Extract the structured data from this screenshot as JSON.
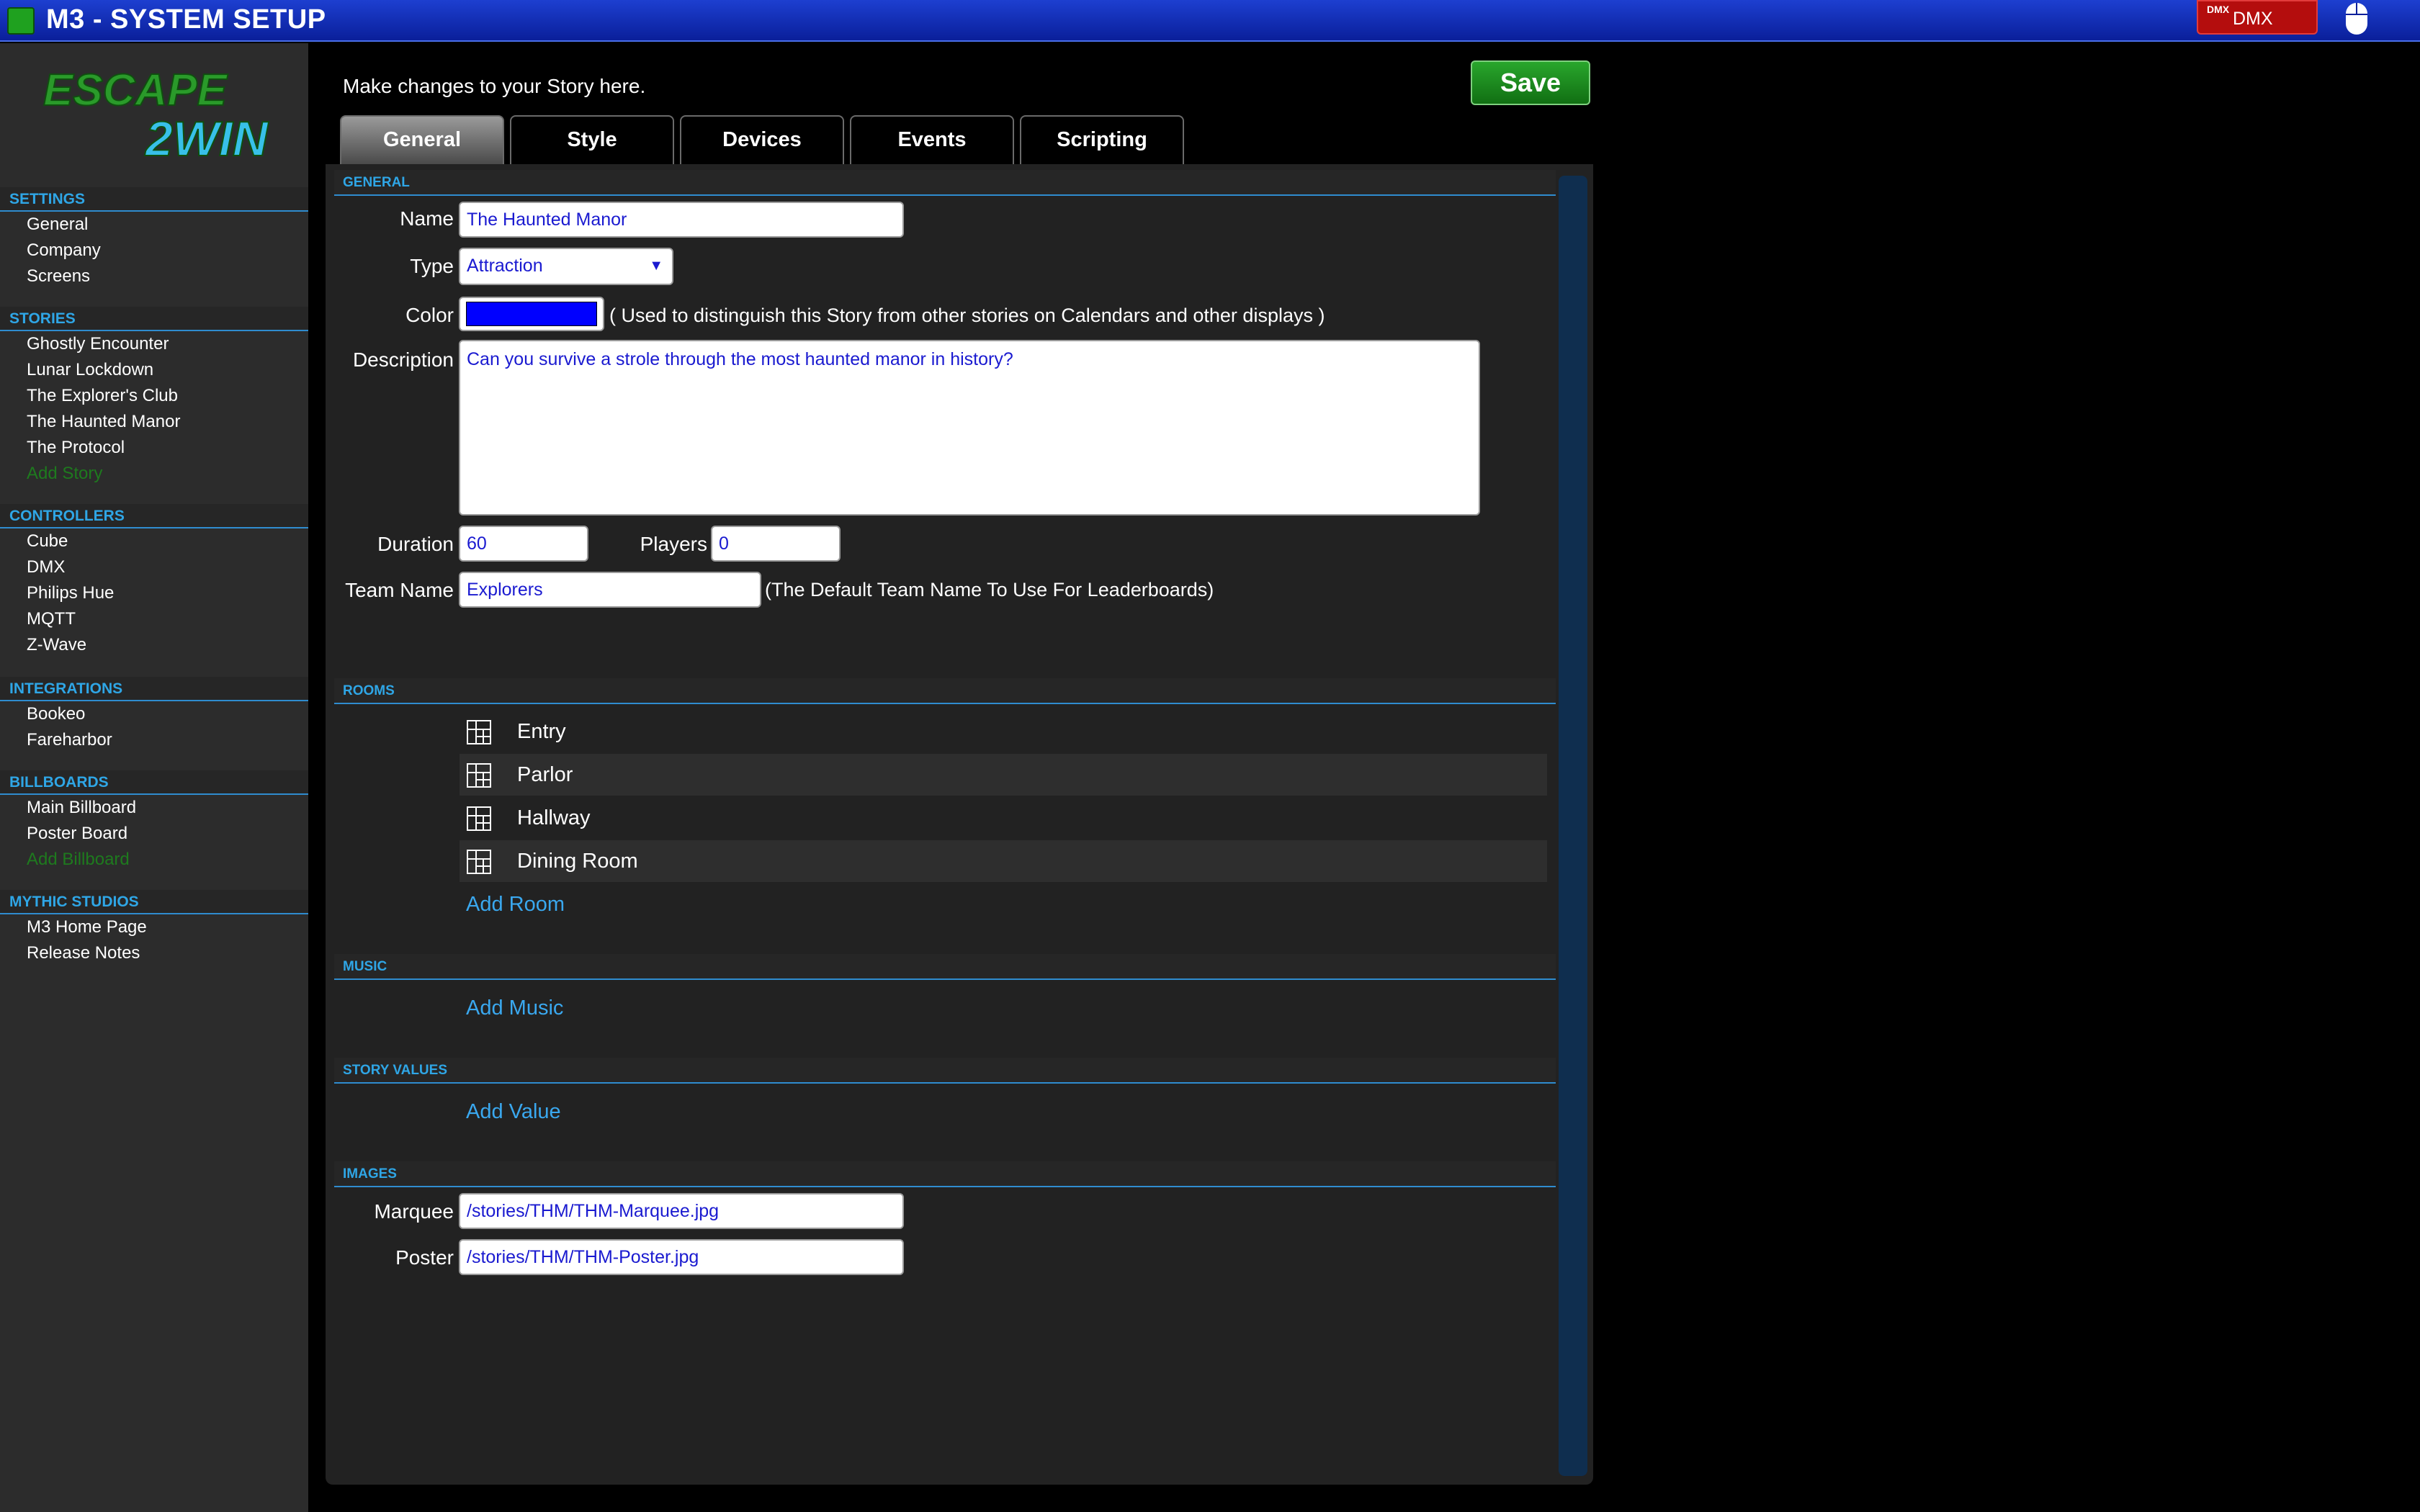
{
  "app": {
    "title": "M3 - SYSTEM SETUP",
    "dmx_label": "DMX",
    "dmx_logo": "DMX"
  },
  "logo": {
    "line1": "ESCAPE",
    "line2": "2WIN"
  },
  "sidebar": {
    "sections": [
      {
        "header": "SETTINGS",
        "items": [
          "General",
          "Company",
          "Screens"
        ]
      },
      {
        "header": "STORIES",
        "items": [
          "Ghostly Encounter",
          "Lunar Lockdown",
          "The Explorer's Club",
          "The Haunted Manor",
          "The Protocol"
        ],
        "add": "Add Story"
      },
      {
        "header": "CONTROLLERS",
        "items": [
          "Cube",
          "DMX",
          "Philips Hue",
          "MQTT",
          "Z-Wave"
        ]
      },
      {
        "header": "INTEGRATIONS",
        "items": [
          "Bookeo",
          "Fareharbor"
        ]
      },
      {
        "header": "BILLBOARDS",
        "items": [
          "Main Billboard",
          "Poster Board"
        ],
        "add": "Add Billboard"
      },
      {
        "header": "MYTHIC STUDIOS",
        "items": [
          "M3 Home Page",
          "Release Notes"
        ]
      }
    ]
  },
  "main": {
    "intro": "Make changes to your Story here.",
    "save_label": "Save",
    "tabs": [
      "General",
      "Style",
      "Devices",
      "Events",
      "Scripting"
    ],
    "active_tab": "General"
  },
  "general": {
    "header": "GENERAL",
    "name_label": "Name",
    "name_value": "The Haunted Manor",
    "type_label": "Type",
    "type_value": "Attraction",
    "color_label": "Color",
    "color_value": "#0000ff",
    "color_note": "( Used to distinguish this Story from other stories on Calendars and other displays )",
    "description_label": "Description",
    "description_value": "Can you survive a strole through the most haunted manor in history?",
    "duration_label": "Duration",
    "duration_value": "60",
    "players_label": "Players",
    "players_value": "0",
    "team_label": "Team Name",
    "team_value": "Explorers",
    "team_note": "(The Default Team Name To Use For Leaderboards)"
  },
  "rooms": {
    "header": "ROOMS",
    "items": [
      "Entry",
      "Parlor",
      "Hallway",
      "Dining Room"
    ],
    "add": "Add Room",
    "icon": "room-grid-icon"
  },
  "music": {
    "header": "MUSIC",
    "add": "Add Music"
  },
  "story_values": {
    "header": "STORY VALUES",
    "add": "Add Value"
  },
  "images": {
    "header": "IMAGES",
    "marquee_label": "Marquee",
    "marquee_value": "/stories/THM/THM-Marquee.jpg",
    "poster_label": "Poster",
    "poster_value": "/stories/THM/THM-Poster.jpg"
  },
  "colors": {
    "titlebar": "#0a1f9a",
    "accent": "#2fa6e6",
    "save": "#1f8f22",
    "link": "#3aa8ef",
    "add_item": "#1e7a1e"
  }
}
